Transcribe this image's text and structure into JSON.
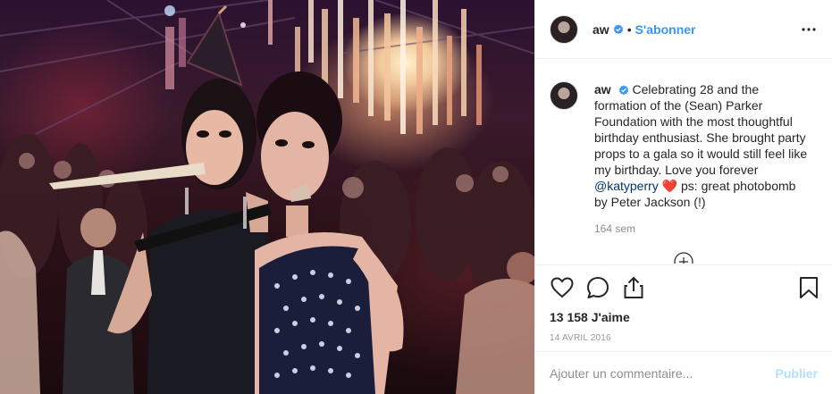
{
  "post": {
    "username": "aw",
    "follow_label": "S'abonner",
    "dot": "•",
    "caption": {
      "username": "aw",
      "text_before": "Celebrating 28 and the formation of the (Sean) Parker Foundation with the most thoughtful birthday enthusiast. She brought party props to a gala so it would still feel like my birthday. Love you forever ",
      "mention": "@katyperry",
      "heart": "❤️",
      "text_after": " ps: great photobomb by Peter Jackson (!)"
    },
    "time_ago": "164 sem",
    "likes": "13 158 J'aime",
    "date": "14 AVRIL 2016",
    "comment": {
      "placeholder": "Ajouter un commentaire...",
      "publish_label": "Publier"
    }
  },
  "icons": {
    "verified": "verified-badge-icon",
    "more": "more-options-icon",
    "like": "heart-icon",
    "comment": "comment-icon",
    "share": "share-icon",
    "save": "bookmark-icon",
    "load_more": "load-more-comments-icon"
  },
  "colors": {
    "accent": "#3897f0",
    "mention": "#003569",
    "muted": "#8e8e8e",
    "publish_disabled": "#b2dffc",
    "heart": "#e0245e"
  }
}
